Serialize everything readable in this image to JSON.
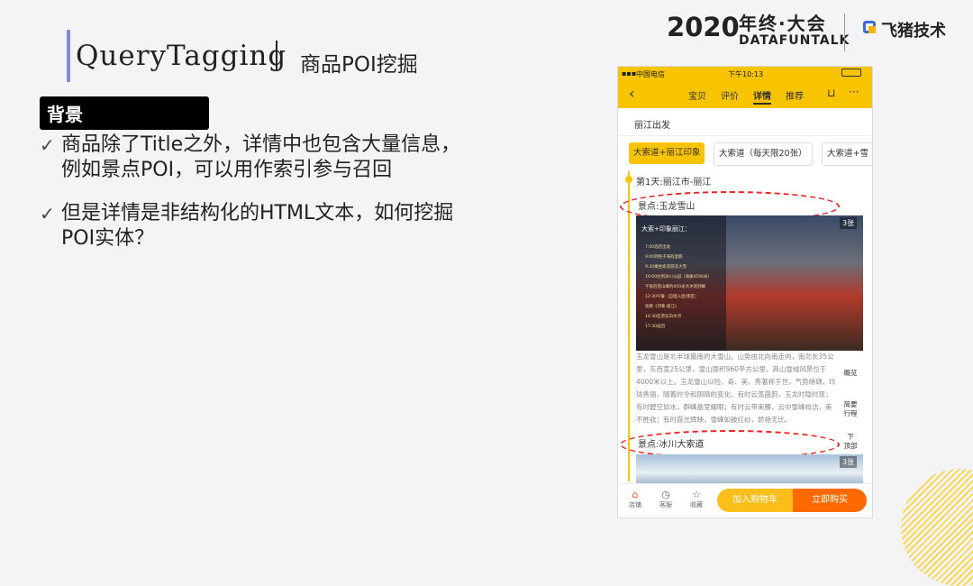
{
  "slide": {
    "title": "QueryTagging",
    "subtitle": "商品POI挖掘",
    "brand": {
      "year": "2020",
      "event_cn": "年终·大会",
      "event_en": "DATAFUNTALK",
      "company": "飞猪技术"
    },
    "section_label": "背景",
    "bullets": [
      {
        "line1": "商品除了Title之外，详情中也包含大量信息，",
        "line2": "例如景点POI，可以用作索引参与召回"
      },
      {
        "line1": "但是详情是非结构化的HTML文本，如何挖掘",
        "line2": "POI实体？"
      }
    ]
  },
  "phone": {
    "status": {
      "carrier": "中国电信",
      "time": "下午10:13"
    },
    "nav": {
      "tabs": [
        "宝贝",
        "评价",
        "详情",
        "推荐"
      ],
      "active": "详情"
    },
    "section_tab": "丽江出发",
    "chips": [
      "大索道+丽江印象",
      "大索道（每天限20张）",
      "大索道+雪"
    ],
    "day_label": "第1天:丽江市-丽江",
    "poi1": "景点:玉龙雪山",
    "poi2": "景点:冰川大索道",
    "photo_count1": "3张",
    "photo_count2": "3张",
    "overlay": {
      "title": "大索+印象丽江：",
      "items": [
        "7:00酒店出发",
        "9:00到牦子海有蛋糕",
        "9:30乘坐索道游览大雪",
        "10:00达到冰川公园（海拔4506米）",
        "午饭后登山峰约450米大冰道到峰",
        "12:30午餐（自理入团/景区）",
        "观看《印象·丽江》",
        "14:30后游览白水河",
        "17:30返回"
      ]
    },
    "description": "玉龙雪山是北半球最南的大雪山。山势由北向南走向，南北长35公里，东西宽25公里，雪山面积960平方公里，高山雪域风景位于4000米以上。玉龙雪山以险、奇、美、秀著称于世，气势磅礴，玲珑秀丽，随着时令和阴晴的变化，有时云蒸霞蔚，玉龙时隐时现；有时碧空如水，群峰晶莹耀眼；有时云带束腰，云中雪峰皎洁，美不胜收；有时霞光辉映，雪峰如披红纱，娇艳无比。",
    "side": {
      "overview": "概览",
      "itinerary1": "简要",
      "itinerary2": "行程",
      "top1": "下",
      "top2": "顶部"
    },
    "bottom": {
      "store": "店铺",
      "service": "客服",
      "favorite": "收藏",
      "cart": "加入购物车",
      "buy": "立即购买"
    }
  }
}
